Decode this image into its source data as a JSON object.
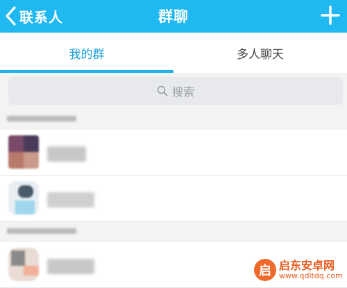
{
  "header": {
    "back_label": "联系人",
    "title": "群聊",
    "plus_icon": "plus-icon",
    "color": "#1fb8f0"
  },
  "tabs": [
    {
      "label": "我的群",
      "active": true
    },
    {
      "label": "多人聊天",
      "active": false
    }
  ],
  "search": {
    "placeholder": "搜索",
    "icon": "search-icon"
  },
  "watermark": {
    "line1": "启东安卓网",
    "line2": "www.qdltdq.com",
    "logo": "启"
  }
}
